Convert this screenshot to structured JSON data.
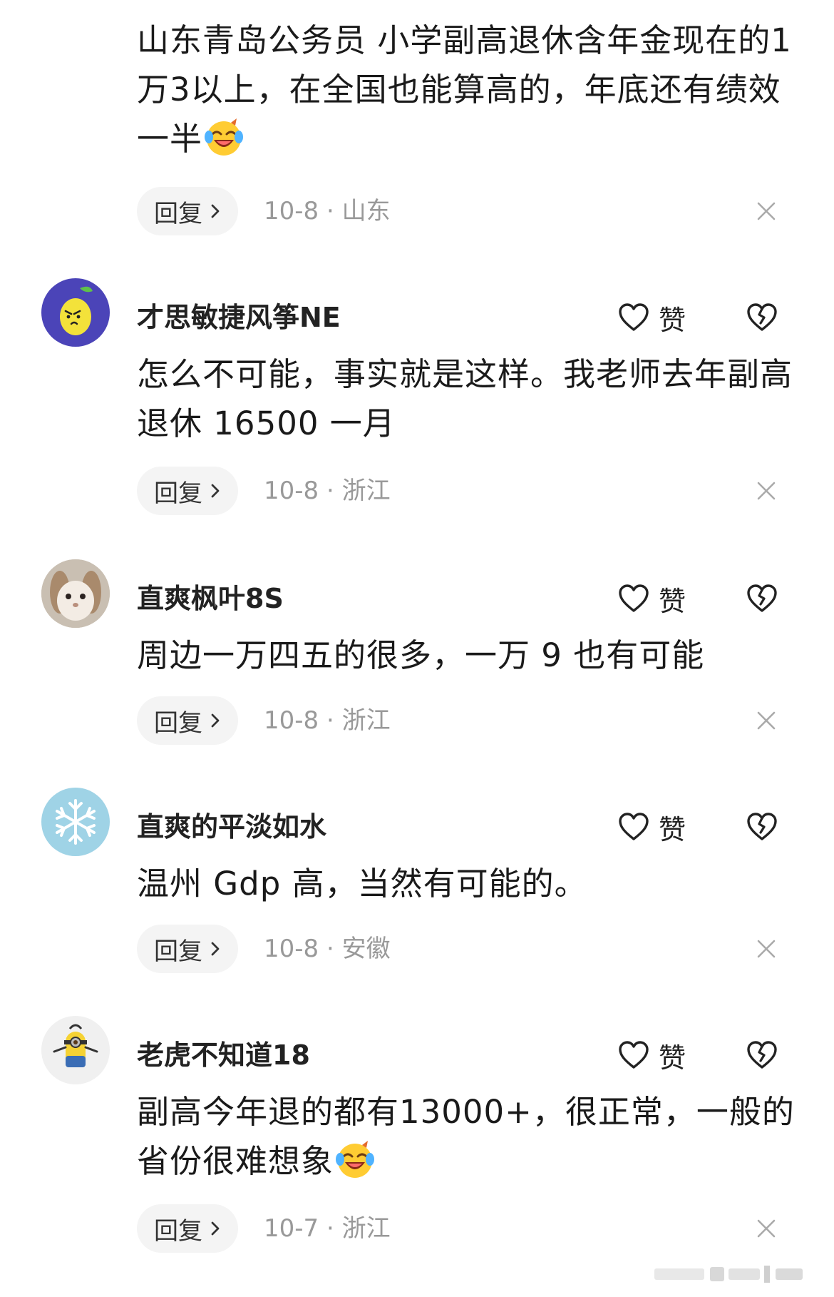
{
  "comments": [
    {
      "text": "山东青岛公务员 小学副高退休含年金现在的1万3以上，在全国也能算高的，年底还有绩效一半",
      "emoji": "laughing-crying-emoji",
      "reply_label": "回复",
      "date": "10-8",
      "separator": " · ",
      "location": "山东"
    },
    {
      "username": "才思敏捷风筝NE",
      "avatar": "lemon-avatar",
      "like_label": "赞",
      "text": "怎么不可能，事实就是这样。我老师去年副高退休 16500 一月",
      "reply_label": "回复",
      "date": "10-8",
      "separator": " · ",
      "location": "浙江"
    },
    {
      "username": "直爽枫叶8S",
      "avatar": "rabbit-avatar",
      "like_label": "赞",
      "text": "周边一万四五的很多，一万 9 也有可能",
      "reply_label": "回复",
      "date": "10-8",
      "separator": " · ",
      "location": "浙江"
    },
    {
      "username": "直爽的平淡如水",
      "avatar": "snowflake-avatar",
      "like_label": "赞",
      "text": "温州 Gdp 高，当然有可能的。",
      "reply_label": "回复",
      "date": "10-8",
      "separator": " · ",
      "location": "安徽"
    },
    {
      "username": "老虎不知道18",
      "avatar": "minion-avatar",
      "like_label": "赞",
      "text": "副高今年退的都有13000+，很正常，一般的省份很难想象",
      "emoji": "laughing-crying-emoji",
      "reply_label": "回复",
      "date": "10-7",
      "separator": " · ",
      "location": "浙江"
    }
  ],
  "colors": {
    "text": "#1a1a1a",
    "meta": "#999999",
    "reply_bg": "#f4f4f4",
    "accent_lemon_bg": "#4b44b8",
    "lemon": "#f3e23a",
    "snow_bg": "#9fd3e6"
  }
}
